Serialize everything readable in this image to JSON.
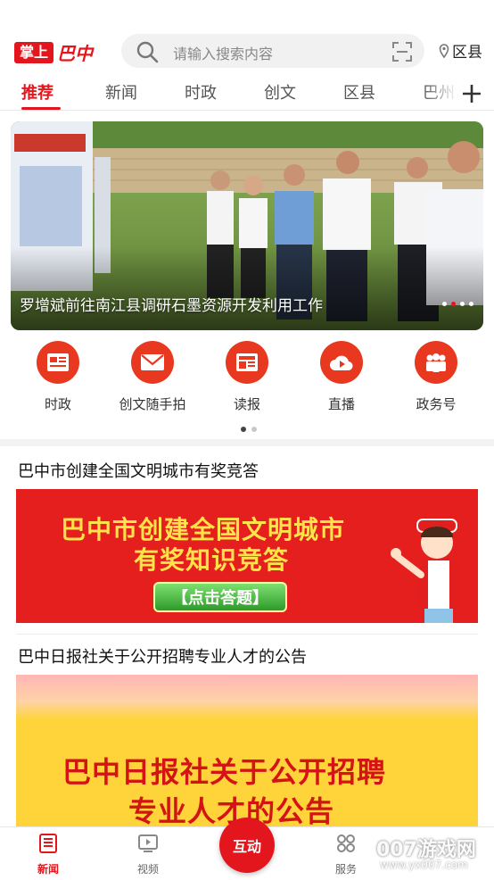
{
  "header": {
    "logo_box": "掌上",
    "logo_script": "巴中",
    "search_placeholder": "请输入搜索内容",
    "location": "区县"
  },
  "tabs": [
    {
      "label": "推荐",
      "active": true
    },
    {
      "label": "新闻"
    },
    {
      "label": "时政"
    },
    {
      "label": "创文"
    },
    {
      "label": "区县"
    },
    {
      "label": "巴州"
    }
  ],
  "banner": {
    "caption": "罗增斌前往南江县调研石墨资源开发利用工作",
    "dots_total": 4,
    "dots_active": 2
  },
  "quick_links": [
    {
      "label": "时政",
      "icon": "newspaper-card-icon"
    },
    {
      "label": "创文随手拍",
      "icon": "envelope-icon"
    },
    {
      "label": "读报",
      "icon": "newspaper-icon"
    },
    {
      "label": "直播",
      "icon": "cloud-play-icon"
    },
    {
      "label": "政务号",
      "icon": "people-icon"
    }
  ],
  "articles": [
    {
      "title": "巴中市创建全国文明城市有奖竞答",
      "ad_line1": "巴中市创建全国文明城市",
      "ad_line2": "有奖知识竞答",
      "ad_button": "【点击答题】"
    },
    {
      "title": "巴中日报社关于公开招聘专业人才的公告",
      "ad_line1": "巴中日报社关于公开招聘",
      "ad_line2": "专业人才的公告"
    }
  ],
  "bottom_nav": {
    "items": [
      {
        "label": "新闻",
        "icon": "news-icon",
        "active": true
      },
      {
        "label": "视频",
        "icon": "video-icon"
      },
      {
        "label": "服务",
        "icon": "grid-icon"
      }
    ],
    "center_label": "互动"
  },
  "watermark": {
    "line1": "007游戏网",
    "line2": "www.yx007.com"
  },
  "colors": {
    "brand_red": "#e4161d",
    "icon_orange": "#e8381f"
  }
}
